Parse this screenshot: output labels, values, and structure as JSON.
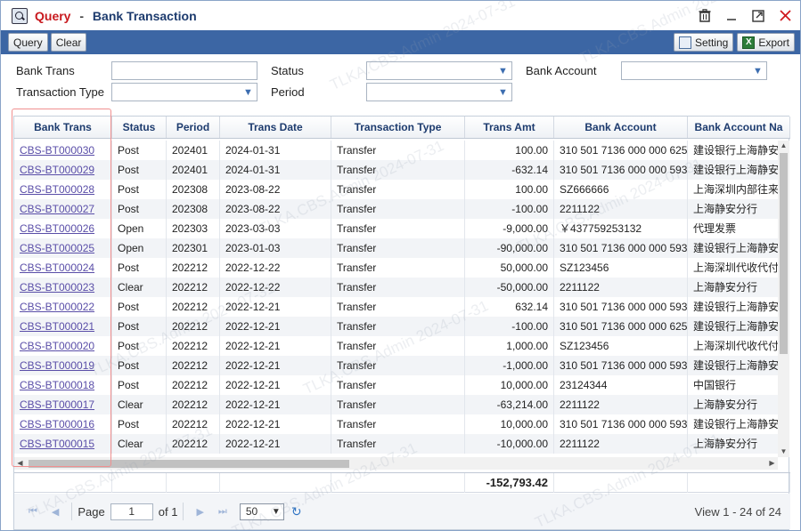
{
  "window": {
    "title_prefix": "Query",
    "title_separator": "-",
    "title": "Bank Transaction"
  },
  "toolbar": {
    "query_label": "Query",
    "clear_label": "Clear",
    "setting_label": "Setting",
    "export_label": "Export"
  },
  "filters": {
    "bank_trans_label": "Bank Trans",
    "status_label": "Status",
    "bank_account_label": "Bank Account",
    "transaction_type_label": "Transaction Type",
    "period_label": "Period"
  },
  "columns": [
    "Bank Trans",
    "Status",
    "Period",
    "Trans Date",
    "Transaction Type",
    "Trans Amt",
    "Bank Account",
    "Bank Account Na"
  ],
  "rows": [
    [
      "CBS-BT000030",
      "Post",
      "202401",
      "2024-01-31",
      "Transfer",
      "100.00",
      "310 501 7136 000 000 625",
      "建设银行上海静安"
    ],
    [
      "CBS-BT000029",
      "Post",
      "202401",
      "2024-01-31",
      "Transfer",
      "-632.14",
      "310 501 7136 000 000 593",
      "建设银行上海静安"
    ],
    [
      "CBS-BT000028",
      "Post",
      "202308",
      "2023-08-22",
      "Transfer",
      "100.00",
      "SZ666666",
      "上海深圳内部往来"
    ],
    [
      "CBS-BT000027",
      "Post",
      "202308",
      "2023-08-22",
      "Transfer",
      "-100.00",
      "2211122",
      "上海静安分行"
    ],
    [
      "CBS-BT000026",
      "Open",
      "202303",
      "2023-03-03",
      "Transfer",
      "-9,000.00",
      "￥437759253132",
      "代理发票"
    ],
    [
      "CBS-BT000025",
      "Open",
      "202301",
      "2023-01-03",
      "Transfer",
      "-90,000.00",
      "310 501 7136 000 000 593",
      "建设银行上海静安"
    ],
    [
      "CBS-BT000024",
      "Post",
      "202212",
      "2022-12-22",
      "Transfer",
      "50,000.00",
      "SZ123456",
      "上海深圳代收代付"
    ],
    [
      "CBS-BT000023",
      "Clear",
      "202212",
      "2022-12-22",
      "Transfer",
      "-50,000.00",
      "2211122",
      "上海静安分行"
    ],
    [
      "CBS-BT000022",
      "Post",
      "202212",
      "2022-12-21",
      "Transfer",
      "632.14",
      "310 501 7136 000 000 593",
      "建设银行上海静安"
    ],
    [
      "CBS-BT000021",
      "Post",
      "202212",
      "2022-12-21",
      "Transfer",
      "-100.00",
      "310 501 7136 000 000 625",
      "建设银行上海静安"
    ],
    [
      "CBS-BT000020",
      "Post",
      "202212",
      "2022-12-21",
      "Transfer",
      "1,000.00",
      "SZ123456",
      "上海深圳代收代付"
    ],
    [
      "CBS-BT000019",
      "Post",
      "202212",
      "2022-12-21",
      "Transfer",
      "-1,000.00",
      "310 501 7136 000 000 593",
      "建设银行上海静安"
    ],
    [
      "CBS-BT000018",
      "Post",
      "202212",
      "2022-12-21",
      "Transfer",
      "10,000.00",
      "23124344",
      "中国银行"
    ],
    [
      "CBS-BT000017",
      "Clear",
      "202212",
      "2022-12-21",
      "Transfer",
      "-63,214.00",
      "2211122",
      "上海静安分行"
    ],
    [
      "CBS-BT000016",
      "Post",
      "202212",
      "2022-12-21",
      "Transfer",
      "10,000.00",
      "310 501 7136 000 000 593",
      "建设银行上海静安"
    ],
    [
      "CBS-BT000015",
      "Clear",
      "202212",
      "2022-12-21",
      "Transfer",
      "-10,000.00",
      "2211122",
      "上海静安分行"
    ]
  ],
  "footer": {
    "total_amt": "-152,793.42"
  },
  "pager": {
    "page_label": "Page",
    "page_value": "1",
    "of_label": "of 1",
    "page_size": "50",
    "view_info": "View 1 - 24 of 24"
  },
  "watermark": "TLKA.CBS.Admin 2024-07-31",
  "colors": {
    "accent": "#3c66a4",
    "title_red": "#c8191e",
    "link": "#5a4ea8",
    "highlight": "#f09090"
  }
}
